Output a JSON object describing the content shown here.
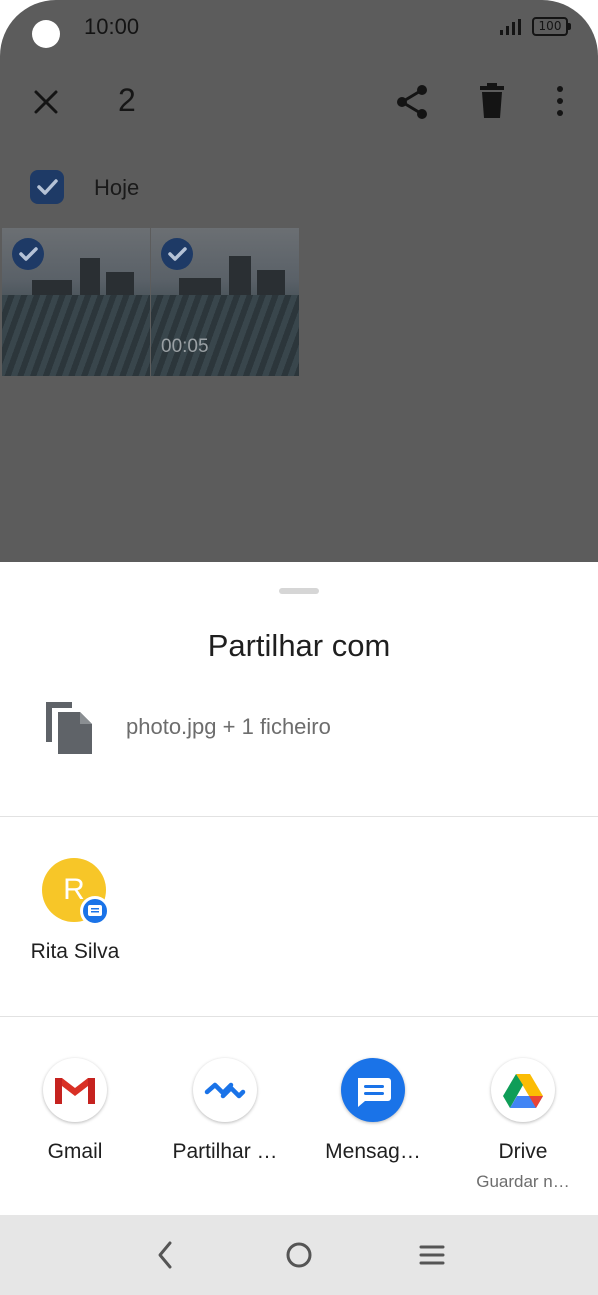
{
  "status_bar": {
    "time": "10:00",
    "battery": "100"
  },
  "toolbar": {
    "selected_count": "2"
  },
  "gallery": {
    "section_label": "Hoje",
    "items": [
      {
        "kind": "photo",
        "duration": ""
      },
      {
        "kind": "video",
        "duration": "00:05"
      }
    ]
  },
  "share_sheet": {
    "title": "Partilhar com",
    "file_summary": "photo.jpg + 1 ficheiro",
    "contacts": [
      {
        "initial": "R",
        "name": "Rita Silva",
        "badge_icon": "messages-icon"
      }
    ],
    "apps": [
      {
        "label": "Gmail",
        "sub": "",
        "icon": "gmail-icon"
      },
      {
        "label": "Partilhar …",
        "sub": "",
        "icon": "nearby-share-icon"
      },
      {
        "label": "Mensag…",
        "sub": "",
        "icon": "messages-icon"
      },
      {
        "label": "Drive",
        "sub": "Guardar n…",
        "icon": "drive-icon"
      }
    ]
  },
  "colors": {
    "scrim": "#5c5c5c",
    "check": "#1e3a66",
    "avatar": "#f7c628",
    "accent": "#1a73e8",
    "navbar": "#e6e6e6"
  }
}
